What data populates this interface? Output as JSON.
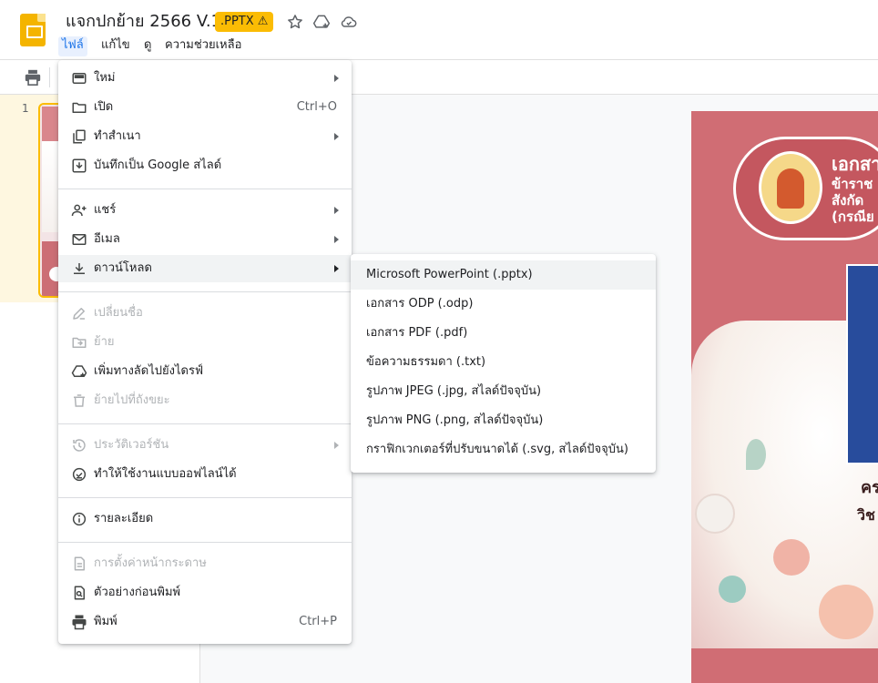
{
  "document": {
    "title": "แจกปกย้าย 2566 V.1",
    "format_badge": ".PPTX ⚠"
  },
  "menubar": {
    "file": "ไฟล์",
    "edit": "แก้ไข",
    "view": "ดู",
    "help": "ความช่วยเหลือ"
  },
  "filmstrip": {
    "slide_number": "1"
  },
  "file_menu": {
    "new": "ใหม่",
    "open": "เปิด",
    "open_shortcut": "Ctrl+O",
    "make_copy": "ทำสำเนา",
    "save_as_google_slides": "บันทึกเป็น Google สไลด์",
    "share": "แชร์",
    "email": "อีเมล",
    "download": "ดาวน์โหลด",
    "rename": "เปลี่ยนชื่อ",
    "move": "ย้าย",
    "add_shortcut": "เพิ่มทางลัดไปยังไดรฟ์",
    "move_to_trash": "ย้ายไปที่ถังขยะ",
    "version_history": "ประวัติเวอร์ชัน",
    "make_offline": "ทำให้ใช้งานแบบออฟไลน์ได้",
    "details": "รายละเอียด",
    "page_setup": "การตั้งค่าหน้ากระดาษ",
    "print_preview": "ตัวอย่างก่อนพิมพ์",
    "print": "พิมพ์",
    "print_shortcut": "Ctrl+P"
  },
  "download_submenu": {
    "items": [
      "Microsoft PowerPoint (.pptx)",
      "เอกสาร ODP (.odp)",
      "เอกสาร PDF (.pdf)",
      "ข้อความธรรมดา (.txt)",
      "รูปภาพ JPEG (.jpg, สไลด์ปัจจุบัน)",
      "รูปภาพ PNG (.png, สไลด์ปัจจุบัน)",
      "กราฟิกเวกเตอร์ที่ปรับขนาดได้ (.svg, สไลด์ปัจจุบัน)"
    ]
  },
  "slide_canvas": {
    "pill_line1": "เอกสา",
    "pill_line2": "ข้าราช",
    "pill_line3": "สังกัด",
    "pill_line4": "(กรณีย",
    "body_line1": "คร",
    "body_line2": "วิช"
  },
  "colors": {
    "accent": "#1a73e8",
    "badge": "#fbbc04",
    "slide_rose": "#d06d74",
    "slide_blue": "#284c9c"
  },
  "icons": {
    "star": "star-icon",
    "add_to_drive": "add-to-drive-icon",
    "cloud_status": "cloud-status-icon",
    "print": "print-icon"
  }
}
